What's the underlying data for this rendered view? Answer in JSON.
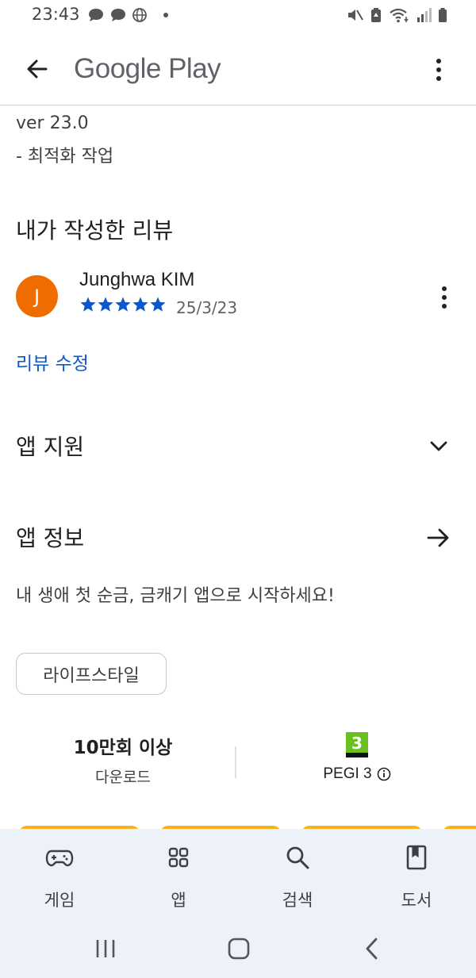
{
  "status_bar": {
    "time": "23:43"
  },
  "app_bar": {
    "title": "Google Play"
  },
  "whats_new": {
    "version": "ver 23.0",
    "note": "- 최적화 작업"
  },
  "my_review": {
    "title": "내가 작성한 리뷰",
    "avatar_initial": "J",
    "reviewer_name": "Junghwa KIM",
    "rating": 5,
    "date": "25/3/23",
    "edit_label": "리뷰 수정"
  },
  "app_support": {
    "title": "앱 지원"
  },
  "app_info": {
    "title": "앱 정보",
    "description": "내 생애 첫 순금, 금캐기 앱으로 시작하세요!",
    "category": "라이프스타일",
    "downloads_value": "10만회 이상",
    "downloads_label": "다운로드",
    "content_rating_badge": "3",
    "content_rating_label": "PEGI 3"
  },
  "bottom_nav": {
    "items": [
      {
        "label": "게임",
        "icon": "gamepad-icon"
      },
      {
        "label": "앱",
        "icon": "apps-grid-icon"
      },
      {
        "label": "검색",
        "icon": "search-icon"
      },
      {
        "label": "도서",
        "icon": "book-icon"
      }
    ]
  },
  "colors": {
    "accent_blue": "#0b57d0",
    "avatar_orange": "#ef6c00",
    "star_blue": "#0b57d0",
    "pegi_green": "#6bbf1f",
    "nav_background": "#edf2fa"
  }
}
